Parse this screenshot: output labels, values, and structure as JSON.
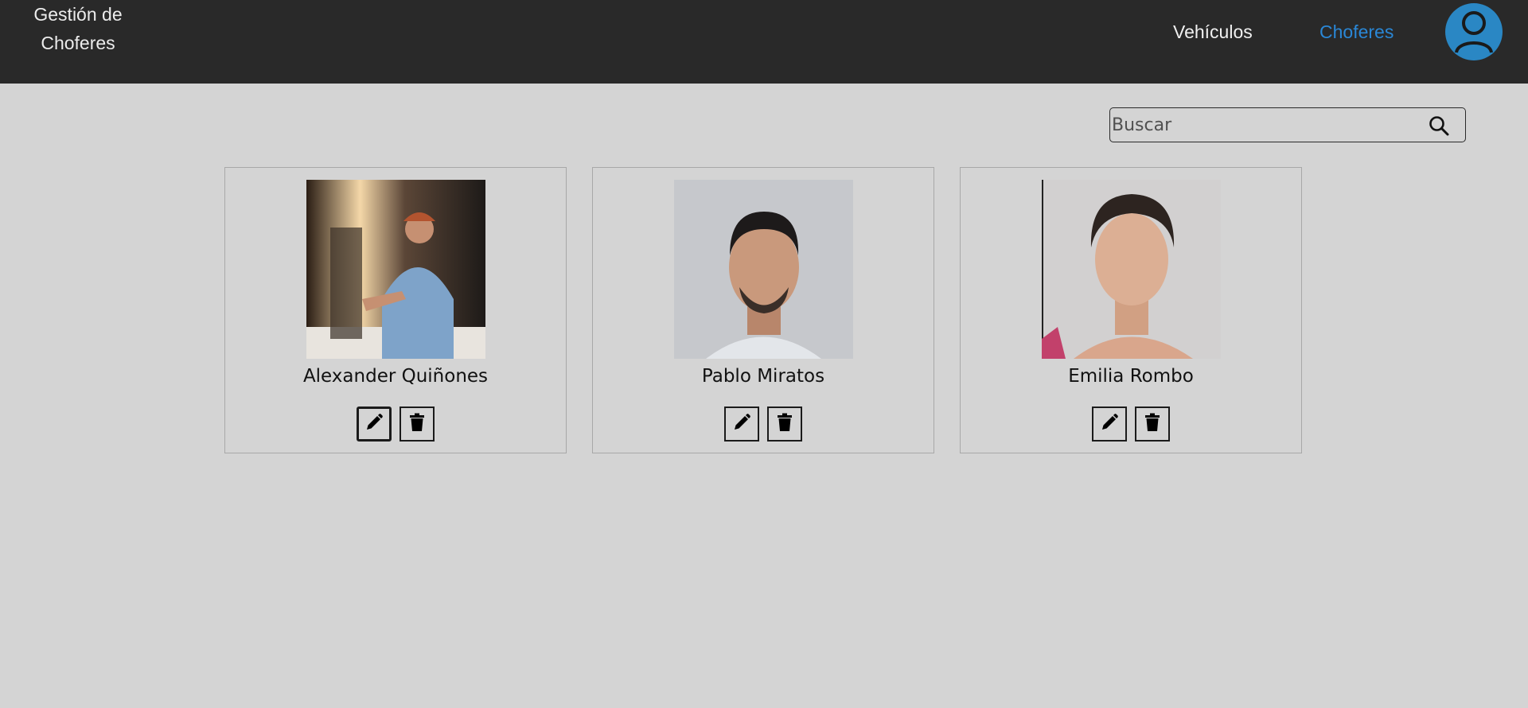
{
  "header": {
    "brand": "Gestión de Choferes",
    "nav": [
      {
        "label": "Vehículos",
        "active": false
      },
      {
        "label": "Choferes",
        "active": true
      }
    ],
    "active_color": "#2a87d6",
    "avatar_icon": "user-avatar-icon"
  },
  "search": {
    "placeholder": "Buscar",
    "value": "",
    "icon": "search-icon"
  },
  "drivers": [
    {
      "name": "Alexander Quiñones",
      "photo": "driver-photo-truck-cab"
    },
    {
      "name": "Pablo Miratos",
      "photo": "driver-photo-portrait"
    },
    {
      "name": "Emilia Rombo",
      "photo": "driver-photo-portrait"
    }
  ],
  "actions": {
    "edit_icon": "pencil-icon",
    "delete_icon": "trash-icon"
  }
}
